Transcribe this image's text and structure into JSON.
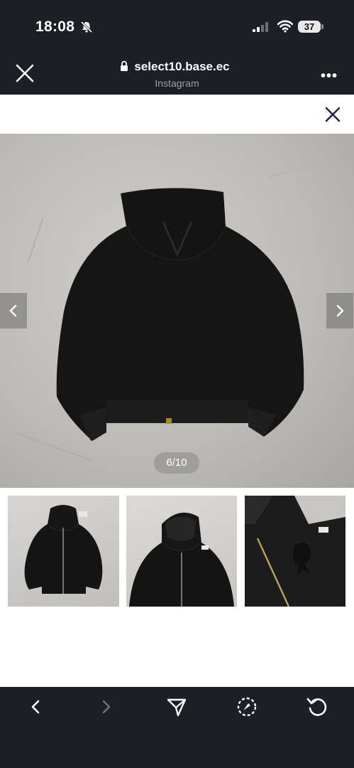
{
  "status_bar": {
    "time": "18:08",
    "battery": "37",
    "icons": [
      "bell-slash-icon",
      "signal-icon",
      "wifi-icon",
      "battery-icon"
    ]
  },
  "browser_header": {
    "url": "select10.base.ec",
    "source": "Instagram",
    "close_icon": "close-icon",
    "lock_icon": "lock-icon",
    "more_icon": "more-icon",
    "more_label": "•••"
  },
  "viewer": {
    "close_icon": "close-icon",
    "counter": "6/10",
    "prev_icon": "chevron-left-icon",
    "next_icon": "chevron-right-icon",
    "current_index": 6,
    "total": 10,
    "thumbnails": [
      "hoodie-front-thumbnail",
      "hoodie-front-close-thumbnail",
      "hoodie-detail-thumbnail"
    ]
  },
  "toolbar": {
    "items": [
      "back-icon",
      "forward-icon",
      "share-icon",
      "compass-icon",
      "reload-icon"
    ],
    "forward_enabled": false
  },
  "colors": {
    "chrome": "#1c1f26",
    "accent_icon": "#1f2a44",
    "disabled_icon": "#6b7080"
  }
}
